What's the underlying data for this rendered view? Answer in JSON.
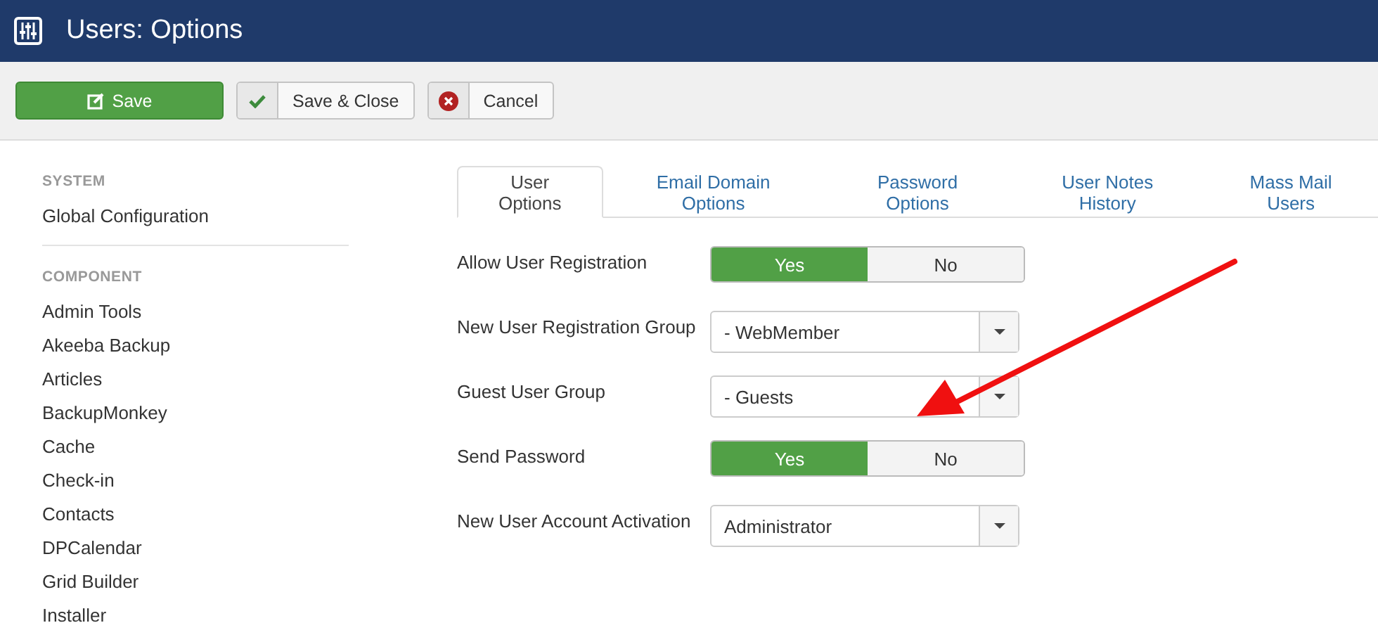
{
  "header": {
    "title": "Users: Options"
  },
  "toolbar": [
    {
      "kind": "primary",
      "label": "Save"
    },
    {
      "kind": "check",
      "label": "Save & Close"
    },
    {
      "kind": "cancel",
      "label": "Cancel"
    }
  ],
  "sidebar": {
    "sections": [
      {
        "heading": "SYSTEM",
        "items": [
          "Global Configuration"
        ]
      },
      {
        "heading": "COMPONENT",
        "items": [
          "Admin Tools",
          "Akeeba Backup",
          "Articles",
          "BackupMonkey",
          "Cache",
          "Check-in",
          "Contacts",
          "DPCalendar",
          "Grid Builder",
          "Installer"
        ]
      }
    ]
  },
  "tabs": [
    {
      "label": "User Options",
      "selected": true
    },
    {
      "label": "Email Domain Options",
      "selected": false
    },
    {
      "label": "Password Options",
      "selected": false
    },
    {
      "label": "User Notes History",
      "selected": false
    },
    {
      "label": "Mass Mail Users",
      "selected": false
    }
  ],
  "fields": [
    {
      "kind": "toggle",
      "label": "Allow User Registration",
      "options": [
        {
          "label": "Yes",
          "selected": true
        },
        {
          "label": "No",
          "selected": false
        }
      ]
    },
    {
      "kind": "select",
      "label": "New User Registration Group",
      "value": "- WebMember"
    },
    {
      "kind": "select",
      "label": "Guest User Group",
      "value": "- Guests"
    },
    {
      "kind": "toggle",
      "label": "Send Password",
      "options": [
        {
          "label": "Yes",
          "selected": true
        },
        {
          "label": "No",
          "selected": false
        }
      ]
    },
    {
      "kind": "select",
      "label": "New User Account Activation",
      "value": "Administrator"
    }
  ]
}
